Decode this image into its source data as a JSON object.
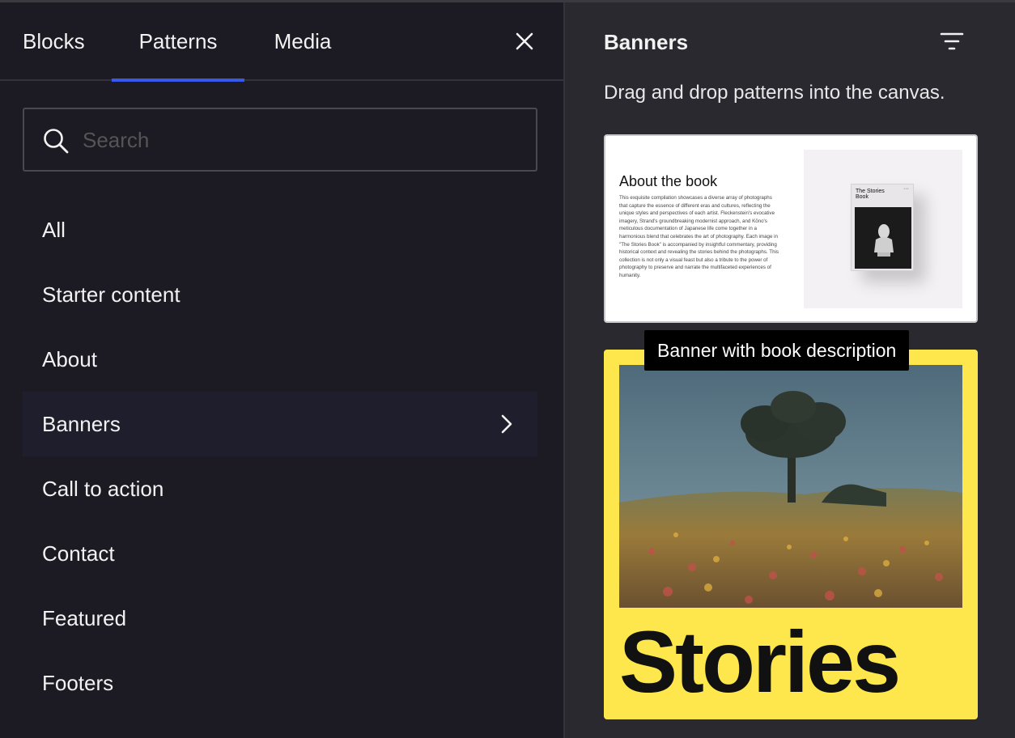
{
  "tabs": {
    "blocks": "Blocks",
    "patterns": "Patterns",
    "media": "Media"
  },
  "search": {
    "value": "",
    "placeholder": "Search"
  },
  "categories": [
    {
      "label": "All"
    },
    {
      "label": "Starter content"
    },
    {
      "label": "About"
    },
    {
      "label": "Banners",
      "active": true
    },
    {
      "label": "Call to action"
    },
    {
      "label": "Contact"
    },
    {
      "label": "Featured"
    },
    {
      "label": "Footers"
    }
  ],
  "panel": {
    "title": "Banners",
    "description": "Drag and drop patterns into the canvas."
  },
  "pattern1": {
    "heading": "About the book",
    "body": "This exquisite compilation showcases a diverse array of photographs that capture the essence of different eras and cultures, reflecting the unique styles and perspectives of each artist. Fleckenstein's evocative imagery, Strand's groundbreaking modernist approach, and Kōno's meticulous documentation of Japanese life come together in a harmonious blend that celebrates the art of photography. Each image in \"The Stories Book\" is accompanied by insightful commentary, providing historical context and revealing the stories behind the photographs. This collection is not only a visual feast but also a tribute to the power of photography to preserve and narrate the multifaceted experiences of humanity.",
    "book_title": "The Stories Book",
    "book_dots": "···"
  },
  "tooltip": "Banner with book description",
  "pattern2": {
    "word": "Stories"
  },
  "colors": {
    "accent": "#3858e9",
    "banner_yellow": "#fde74c"
  },
  "icons": {
    "close": "close-icon",
    "search": "search-icon",
    "chevron": "chevron-right-icon",
    "filter": "filter-icon"
  }
}
